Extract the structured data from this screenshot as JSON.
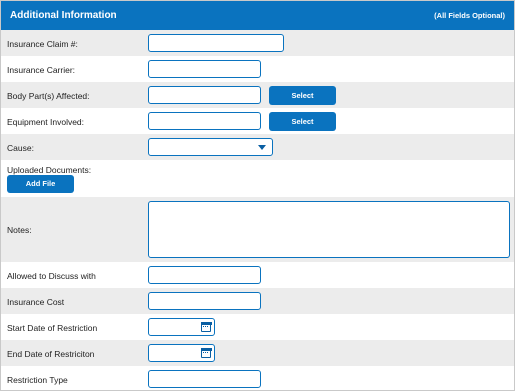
{
  "header": {
    "title": "Additional Information",
    "note": "(All Fields Optional)"
  },
  "fields": {
    "insurance_claim": {
      "label": "Insurance Claim #:",
      "value": ""
    },
    "insurance_carrier": {
      "label": "Insurance Carrier:",
      "value": ""
    },
    "body_parts": {
      "label": "Body Part(s) Affected:",
      "value": "",
      "button": "Select"
    },
    "equipment": {
      "label": "Equipment Involved:",
      "value": "",
      "button": "Select"
    },
    "cause": {
      "label": "Cause:",
      "selected": ""
    },
    "uploaded_documents": {
      "label": "Uploaded Documents:",
      "button": "Add File"
    },
    "notes": {
      "label": "Notes:",
      "value": ""
    },
    "allowed_to_discuss": {
      "label": "Allowed to Discuss with",
      "value": ""
    },
    "insurance_cost": {
      "label": "Insurance Cost",
      "value": ""
    },
    "start_date_restriction": {
      "label": "Start Date of Restriction",
      "value": ""
    },
    "end_date_restriction": {
      "label": "End Date of Restriciton",
      "value": ""
    },
    "restriction_type": {
      "label": "Restriction Type",
      "value": ""
    }
  },
  "colors": {
    "accent": "#0a73bf",
    "row_alt": "#ececec",
    "border": "#d8d8d8"
  },
  "icons": {
    "dropdown": "chevron-down-icon",
    "date": "calendar-icon"
  }
}
